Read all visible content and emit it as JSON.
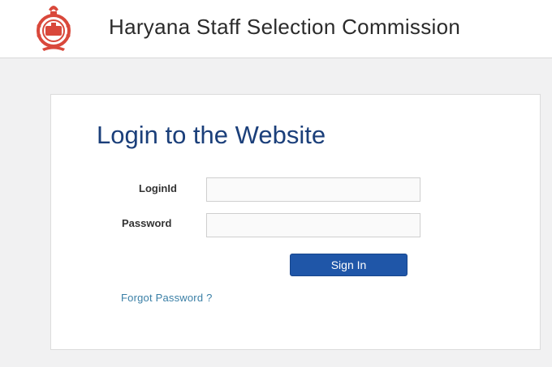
{
  "header": {
    "title": "Haryana Staff Selection Commission",
    "emblem_icon": "state-emblem-icon"
  },
  "login": {
    "heading": "Login to the Website",
    "loginid_label": "LoginId",
    "loginid_value": "",
    "password_label": "Password",
    "password_value": "",
    "signin_label": "Sign In",
    "forgot_label": "Forgot Password ?"
  },
  "colors": {
    "page_background": "#f1f1f2",
    "heading": "#1b3f7a",
    "button": "#1f56a8",
    "link": "#3a7fa6",
    "emblem": "#d9483b"
  }
}
